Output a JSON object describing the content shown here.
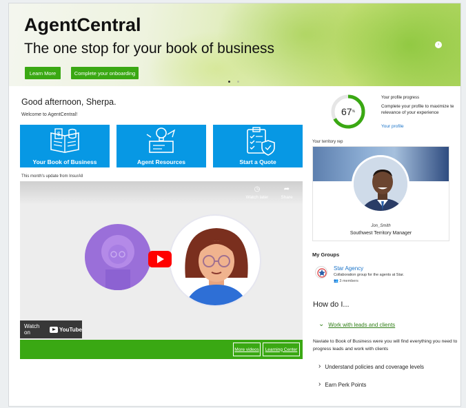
{
  "hero": {
    "title": "AgentCentral",
    "subtitle": "The one stop for your book of business",
    "learn_more": "Learn More",
    "onboarding": "Complete your onboarding",
    "next_icon": "chevron-right-icon"
  },
  "greeting": {
    "title": "Good afternoon, Sherpa.",
    "welcome": "Welcome to AgentCentral!"
  },
  "tiles": [
    {
      "label": "Your Book of Business",
      "icon": "book-icon"
    },
    {
      "label": "Agent Resources",
      "icon": "lightbulb-icon"
    },
    {
      "label": "Start a Quote",
      "icon": "clipboard-shield-icon"
    }
  ],
  "update": {
    "label": "This month's update from InsurAll",
    "watch_later": "Watch later",
    "share": "Share",
    "watch_on": "Watch on",
    "youtube": "YouTube",
    "more_videos": "More videos",
    "learning_center": "Learning Center"
  },
  "profile": {
    "percent": "67",
    "percent_sign": "%",
    "progress_value": 0.67,
    "title": "Your profile progress",
    "text": "Complete your profile to maximize te relevance of your experience",
    "link": "Your profile"
  },
  "territory": {
    "label": "Your territory rep",
    "name": "Jon_Smith",
    "role": "Southwest Territory Manager"
  },
  "groups": {
    "title": "My Groups",
    "items": [
      {
        "name": "Star Agency",
        "desc": "Collaboration group for the agents at Star.",
        "members": "3 members"
      }
    ]
  },
  "howdo": {
    "title": "How do I...",
    "open_item": "Work with leads and clients",
    "open_body": "Naviate to Book of Business were you will find everything you need to progress leads and work with clients",
    "items": [
      "Understand policies and coverage levels",
      "Earn Perk Points"
    ]
  },
  "colors": {
    "green": "#3aa813",
    "blue": "#0798e4",
    "link": "#1a73c8"
  }
}
